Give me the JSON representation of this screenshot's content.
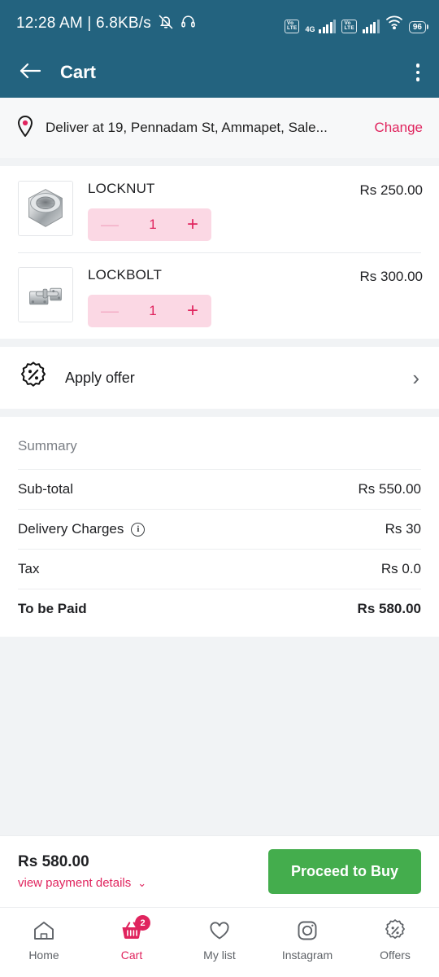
{
  "status_bar": {
    "clock": "12:28 AM | 6.8KB/s",
    "mute_icon": "bell-mute-icon",
    "headphone_icon": "headphone-icon",
    "network_1": "VoLTE",
    "network_gen": "4G",
    "network_2": "VoLTE",
    "wifi_icon": "wifi-icon",
    "battery": "96"
  },
  "app_bar": {
    "back_icon": "arrow-left-icon",
    "title": "Cart",
    "menu_icon": "kebab-menu-icon"
  },
  "address": {
    "pin_icon": "location-pin-icon",
    "text": "Deliver at 19, Pennadam St, Ammapet, Sale...",
    "change_label": "Change"
  },
  "cart_items": [
    {
      "name": "LOCKNUT",
      "price": "Rs 250.00",
      "qty": "1",
      "image": "hex-locknut-photo"
    },
    {
      "name": "LOCKBOLT",
      "price": "Rs 300.00",
      "qty": "1",
      "image": "barrel-bolt-photo"
    }
  ],
  "offer": {
    "icon": "discount-badge-icon",
    "label": "Apply offer",
    "chevron": "›"
  },
  "summary": {
    "title": "Summary",
    "rows": [
      {
        "label": "Sub-total",
        "value": "Rs 550.00"
      },
      {
        "label": "Delivery Charges",
        "value": "Rs 30"
      },
      {
        "label": "Tax",
        "value": "Rs 0.0"
      },
      {
        "label": "To be Paid",
        "value": "Rs 580.00"
      }
    ],
    "info_icon": "info-icon",
    "info_glyph": "i"
  },
  "checkout": {
    "amount": "Rs 580.00",
    "details_label": "view payment details",
    "details_chevron": "⌄",
    "buy_label": "Proceed to Buy"
  },
  "bottom_nav": [
    {
      "label": "Home",
      "icon": "home-icon",
      "badge": ""
    },
    {
      "label": "Cart",
      "icon": "basket-icon",
      "badge": "2"
    },
    {
      "label": "My list",
      "icon": "heart-icon",
      "badge": ""
    },
    {
      "label": "Instagram",
      "icon": "instagram-icon",
      "badge": ""
    },
    {
      "label": "Offers",
      "icon": "offers-badge-icon",
      "badge": ""
    }
  ],
  "colors": {
    "header": "#23637f",
    "accent_pink": "#e0245e",
    "stepper_bg": "#fbd8e4",
    "buy_green": "#44ad4d",
    "page_grey": "#f1f3f5"
  }
}
